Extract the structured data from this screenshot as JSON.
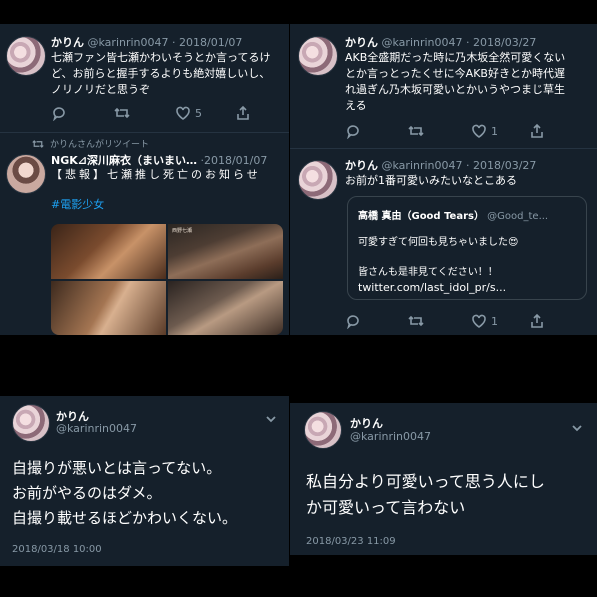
{
  "tl": {
    "tweet1": {
      "name": "かりん",
      "handle_date": "@karinrin0047 · 2018/01/07",
      "lines": [
        "七瀬ファン皆七瀬かわいそうとか言ってるけ",
        "ど、お前らと握手するよりも絶対嬉しいし、",
        "ノリノリだと思うぞ"
      ],
      "like_count": "5"
    },
    "retweet_label": "かりんさんがリツイート",
    "tweet2": {
      "name": "NGK⊿深川麻衣（まいまい…",
      "handle_date": "·2018/01/07",
      "line1": "【悲報】七瀬推し死亡のお知らせ",
      "hashtag": "#電影少女",
      "media_caption": "西野七瀬"
    }
  },
  "tr": {
    "tweet1": {
      "name": "かりん",
      "handle_date": "@karinrin0047 · 2018/03/27",
      "lines": [
        "AKB全盛期だった時に乃木坂全然可愛くない",
        "とか言っとったくせに今AKB好きとか時代遅",
        "れ過ぎん乃木坂可愛いとかいうやつまじ草生",
        "える"
      ],
      "like_count": "1"
    },
    "tweet2": {
      "name": "かりん",
      "handle_date": "@karinrin0047 · 2018/03/27",
      "line1": "お前が1番可愛いみたいなとこある",
      "like_count": "1",
      "quote": {
        "name": "高橋 真由（Good Tears）",
        "handle": "@Good_te...",
        "line1": "可愛すぎて何回も見ちゃいました😍",
        "line2": "皆さんも是非見てください！！",
        "link": "twitter.com/last_idol_pr/s..."
      }
    }
  },
  "bl": {
    "name": "かりん",
    "handle": "@karinrin0047",
    "lines": [
      "自撮りが悪いとは言ってない。",
      "お前がやるのはダメ。",
      "自撮り載せるほどかわいくない。"
    ],
    "date": "2018/03/18 10:00"
  },
  "br": {
    "name": "かりん",
    "handle": "@karinrin0047",
    "lines": [
      "私自分より可愛いって思う人にし",
      "か可愛いって言わない"
    ],
    "date": "2018/03/23 11:09"
  },
  "colors": {
    "bg": "#15202b",
    "muted": "#8899a6",
    "link": "#1da1f2",
    "border": "#38444d"
  }
}
